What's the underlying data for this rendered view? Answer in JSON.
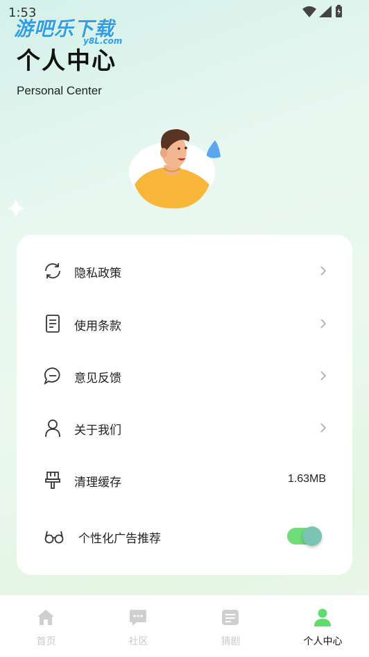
{
  "status_bar": {
    "time": "1:53"
  },
  "watermark": {
    "main": "游吧乐下载",
    "sub": "y8L.com"
  },
  "header": {
    "title": "个人中心",
    "subtitle": "Personal Center"
  },
  "menu": {
    "items": [
      {
        "label": "隐私政策",
        "icon": "refresh-icon",
        "trailing": "chevron"
      },
      {
        "label": "使用条款",
        "icon": "document-icon",
        "trailing": "chevron"
      },
      {
        "label": "意见反馈",
        "icon": "chat-bubble-icon",
        "trailing": "chevron"
      },
      {
        "label": "关于我们",
        "icon": "person-icon",
        "trailing": "chevron"
      },
      {
        "label": "清理缓存",
        "icon": "brush-icon",
        "trailing": "value",
        "value": "1.63MB"
      },
      {
        "label": "个性化广告推荐",
        "icon": "glasses-icon",
        "trailing": "toggle",
        "enabled": true
      }
    ]
  },
  "tabbar": {
    "tabs": [
      {
        "label": "首页",
        "icon": "home-icon",
        "active": false
      },
      {
        "label": "社区",
        "icon": "message-icon",
        "active": false
      },
      {
        "label": "猜剧",
        "icon": "list-icon",
        "active": false
      },
      {
        "label": "个人中心",
        "icon": "person-icon",
        "active": true
      }
    ]
  },
  "colors": {
    "accent": "#5fdc6e",
    "toggle_track": "#6fdc79",
    "toggle_knob": "#79c4b2",
    "inactive_tab": "#c9c9c9"
  }
}
